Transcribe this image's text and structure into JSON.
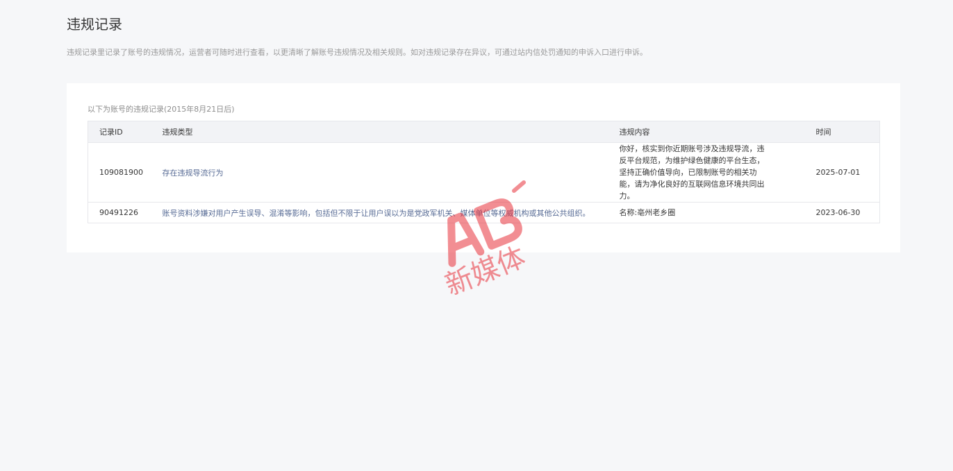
{
  "page": {
    "title": "违规记录",
    "description": "违规记录里记录了账号的违规情况，运营者可随时进行查看，以更清晰了解账号违规情况及相关规则。如对违规记录存在异议，可通过站内信处罚通知的申诉入口进行申诉。"
  },
  "table": {
    "caption": "以下为账号的违规记录(2015年8月21日后)",
    "headers": [
      "记录ID",
      "违规类型",
      "违规内容",
      "时间"
    ],
    "rows": [
      {
        "id": "109081900",
        "type": "存在违规导流行为",
        "content": "你好，核实到你近期账号涉及违规导流，违反平台规范，为维护绿色健康的平台生态，坚持正确价值导向，已限制账号的相关功能，请为净化良好的互联网信息环境共同出力。",
        "time": "2025-07-01"
      },
      {
        "id": "90491226",
        "type": "账号资料涉嫌对用户产生误导、混淆等影响，包括但不限于让用户误以为是党政军机关、媒体单位等权威机构或其他公共组织。",
        "content": "名称:亳州老乡圈",
        "time": "2023-06-30"
      }
    ]
  },
  "watermark": {
    "logo_text": "AB",
    "caption": "新媒体",
    "color": "#e8323c"
  }
}
